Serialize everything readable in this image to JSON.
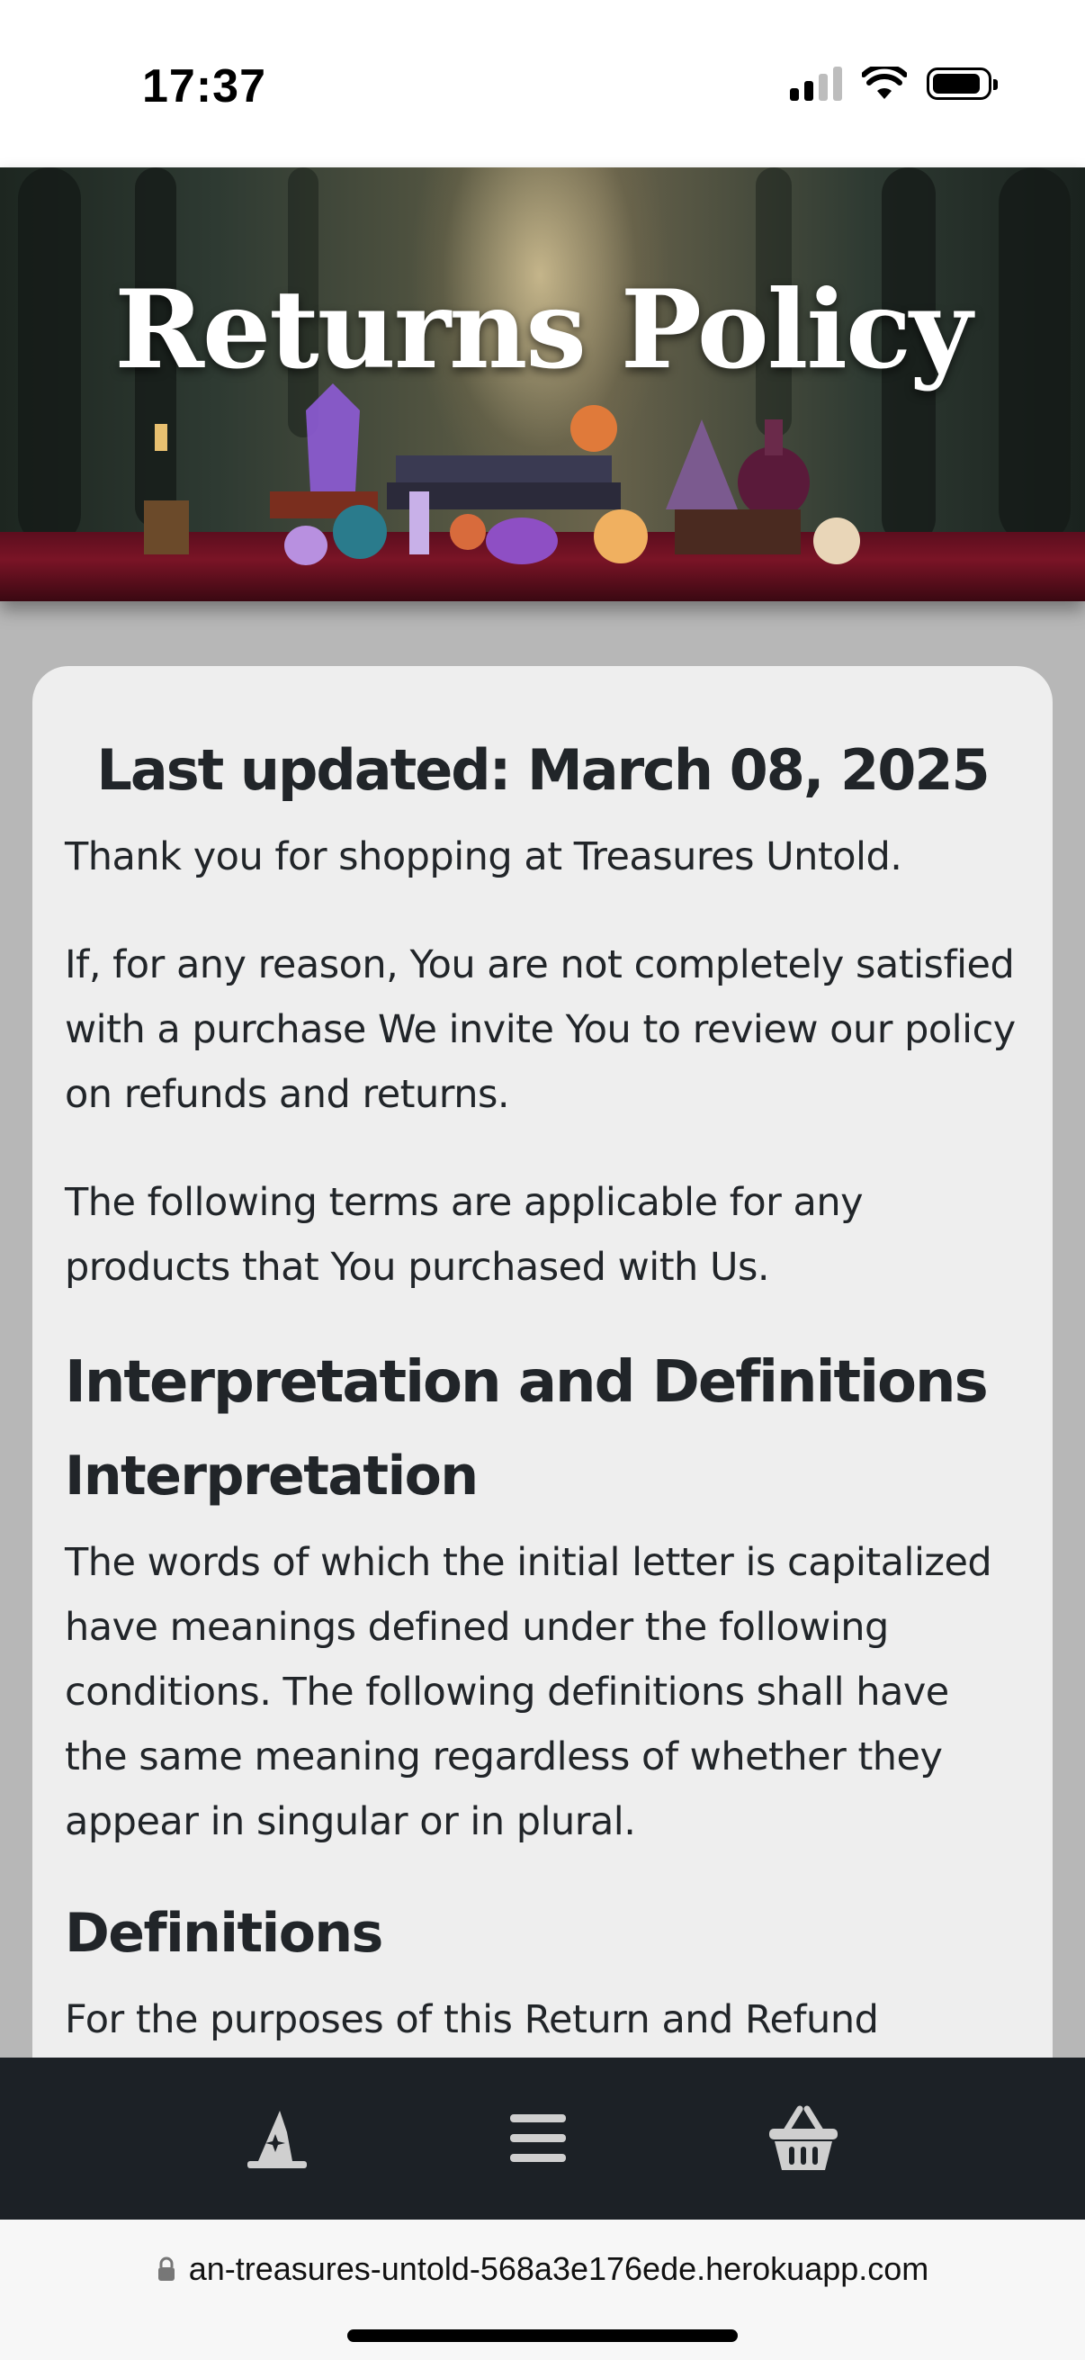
{
  "status_bar": {
    "time": "17:37",
    "icons": [
      "cellular-signal-icon",
      "wifi-icon",
      "battery-icon"
    ]
  },
  "hero": {
    "title": "Returns Policy"
  },
  "content": {
    "last_updated": "Last updated: March 08, 2025",
    "intro_1": "Thank you for shopping at Treasures Untold.",
    "intro_2": "If, for any reason, You are not completely satisfied with a purchase We invite You to review our policy on refunds and returns.",
    "intro_3": "The following terms are applicable for any products that You purchased with Us.",
    "heading_interpretation_definitions": "Interpretation and Definitions",
    "heading_interpretation": "Interpretation",
    "interpretation_text": "The words of which the initial letter is capitalized have meanings defined under the following conditions. The following definitions shall have the same meaning regardless of whether they appear in singular or in plural.",
    "heading_definitions": "Definitions",
    "definitions_text": "For the purposes of this Return and Refund"
  },
  "bottom_nav": {
    "items": [
      {
        "icon": "wizard-hat-icon"
      },
      {
        "icon": "menu-icon"
      },
      {
        "icon": "shopping-basket-icon"
      }
    ]
  },
  "browser": {
    "url": "an-treasures-untold-568a3e176ede.herokuapp.com",
    "lock_icon": "lock-icon"
  },
  "colors": {
    "card_background": "#eeeeee",
    "page_background": "#b7b7b7",
    "nav_background": "#1c2126",
    "text": "#212529"
  }
}
